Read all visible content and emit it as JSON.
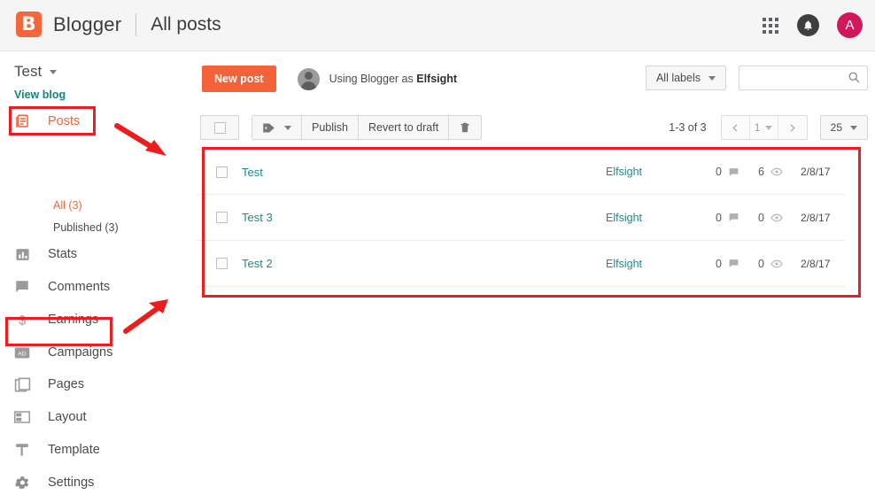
{
  "topbar": {
    "brand": "Blogger",
    "page_title": "All posts",
    "logo_letter": "B",
    "avatar_letter": "A",
    "apps_icon": "apps-grid-icon",
    "bell_icon": "notification-bell-icon",
    "brand_color": "#f5673a",
    "avatar_color": "#d1185d"
  },
  "sidebar": {
    "blog_name": "Test",
    "view_blog": "View blog",
    "items": [
      {
        "label": "Posts",
        "icon": "posts-icon",
        "active": true
      },
      {
        "label": "Stats",
        "icon": "stats-bar-chart-icon",
        "active": false
      },
      {
        "label": "Comments",
        "icon": "comment-bubble-icon",
        "active": false
      },
      {
        "label": "Earnings",
        "icon": "dollar-sign-icon",
        "active": false
      },
      {
        "label": "Campaigns",
        "icon": "ad-badge-icon",
        "active": false
      },
      {
        "label": "Pages",
        "icon": "pages-icon",
        "active": false
      },
      {
        "label": "Layout",
        "icon": "layout-grid-icon",
        "active": false
      },
      {
        "label": "Template",
        "icon": "paint-roller-icon",
        "active": false
      },
      {
        "label": "Settings",
        "icon": "gear-icon",
        "active": false
      }
    ],
    "sub_items": [
      {
        "label": "All (3)",
        "active": true
      },
      {
        "label": "Published (3)",
        "active": false
      }
    ]
  },
  "main": {
    "new_post_label": "New post",
    "using_blogger_prefix": "Using Blogger as ",
    "using_blogger_user": "Elfsight",
    "all_labels_label": "All labels",
    "search_placeholder": "",
    "search_value": "",
    "search_icon": "search-icon",
    "toolbar": {
      "label_icon": "tag-label-icon",
      "publish_label": "Publish",
      "revert_label": "Revert to draft",
      "delete_icon": "trash-icon"
    },
    "pager": {
      "range": "1-3 of 3",
      "prev_icon": "chevron-left-icon",
      "page_number": "1",
      "next_icon": "chevron-right-icon",
      "per_page": "25"
    },
    "table": {
      "rows": [
        {
          "title": "Test",
          "author": "Elfsight",
          "comments": "0",
          "views": "6",
          "date": "2/8/17"
        },
        {
          "title": "Test 3",
          "author": "Elfsight",
          "comments": "0",
          "views": "0",
          "date": "2/8/17"
        },
        {
          "title": "Test 2",
          "author": "Elfsight",
          "comments": "0",
          "views": "0",
          "date": "2/8/17"
        }
      ]
    }
  },
  "annotations": {
    "color": "#ee1c1c",
    "boxes": [
      "posts-nav-highlight",
      "pages-nav-highlight",
      "post-table-highlight"
    ],
    "arrows": [
      "arrow-pointing-to-posts",
      "arrow-pointing-to-pages"
    ]
  }
}
